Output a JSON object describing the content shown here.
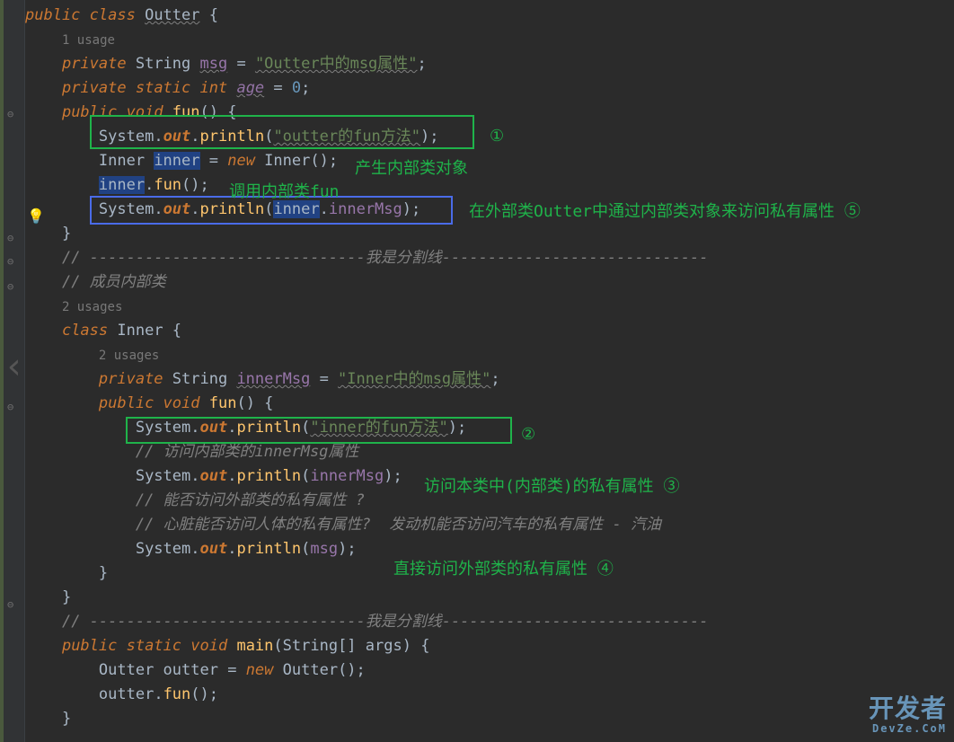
{
  "code": {
    "l1_public": "public ",
    "l1_class": "class ",
    "l1_name": "Outter",
    "l1_brace": " {",
    "l2_usage": "1 usage",
    "l3_private": "private ",
    "l3_type": "String ",
    "l3_var": "msg",
    "l3_eq": " = ",
    "l3_str": "\"Outter中的msg属性\"",
    "l3_semi": ";",
    "l4_private": "private ",
    "l4_static": "static ",
    "l4_int": "int ",
    "l4_var": "age",
    "l4_eq": " = ",
    "l4_num": "0",
    "l4_semi": ";",
    "l5_public": "public ",
    "l5_void": "void ",
    "l5_fun": "fun",
    "l5_paren": "() {",
    "l6_sys": "System",
    "l6_dot1": ".",
    "l6_out": "out",
    "l6_dot2": ".",
    "l6_println": "println",
    "l6_open": "(",
    "l6_str": "\"outter的fun方法\"",
    "l6_close": ");",
    "l7_type": "Inner ",
    "l7_var": "inner",
    "l7_eq": " = ",
    "l7_new": "new ",
    "l7_ctor": "Inner",
    "l7_paren": "();",
    "l8_var": "inner",
    "l8_dot": ".",
    "l8_fun": "fun",
    "l8_paren": "();",
    "l9_sys": "System",
    "l9_dot1": ".",
    "l9_out": "out",
    "l9_dot2": ".",
    "l9_println": "println",
    "l9_open": "(",
    "l9_inner": "inner",
    "l9_dot3": ".",
    "l9_inmsg": "innerMsg",
    "l9_close": ");",
    "l10_brace": "}",
    "l11_comment": "// ------------------------------我是分割线-----------------------------",
    "l12_comment": "// 成员内部类",
    "l13_usage": "2 usages",
    "l14_class": "class ",
    "l14_name": "Inner ",
    "l14_brace": "{",
    "l15_usage": "2 usages",
    "l16_private": "private ",
    "l16_type": "String ",
    "l16_var": "innerMsg",
    "l16_eq": " = ",
    "l16_str": "\"Inner中的msg属性\"",
    "l16_semi": ";",
    "l17_public": "public ",
    "l17_void": "void ",
    "l17_fun": "fun",
    "l17_paren": "() {",
    "l18_sys": "System",
    "l18_dot1": ".",
    "l18_out": "out",
    "l18_dot2": ".",
    "l18_println": "println",
    "l18_open": "(",
    "l18_str": "\"inner的fun方法\"",
    "l18_close": ");",
    "l19_comment": "// 访问内部类的innerMsg属性",
    "l20_sys": "System",
    "l20_dot1": ".",
    "l20_out": "out",
    "l20_dot2": ".",
    "l20_println": "println",
    "l20_open": "(",
    "l20_arg": "innerMsg",
    "l20_close": ");",
    "l21_comment": "// 能否访问外部类的私有属性 ?",
    "l22_comment": "// 心脏能否访问人体的私有属性?  发动机能否访问汽车的私有属性 - 汽油",
    "l23_sys": "System",
    "l23_dot1": ".",
    "l23_out": "out",
    "l23_dot2": ".",
    "l23_println": "println",
    "l23_open": "(",
    "l23_arg": "msg",
    "l23_close": ");",
    "l24_brace": "}",
    "l25_brace": "}",
    "l26_comment": "// ------------------------------我是分割线-----------------------------",
    "l27_public": "public ",
    "l27_static": "static ",
    "l27_void": "void ",
    "l27_main": "main",
    "l27_open": "(",
    "l27_argty": "String[] ",
    "l27_args": "args",
    "l27_close": ") {",
    "l28_type": "Outter ",
    "l28_var": "outter ",
    "l28_eq": "= ",
    "l28_new": "new ",
    "l28_ctor": "Outter",
    "l28_paren": "();",
    "l29_var": "outter",
    "l29_dot": ".",
    "l29_fun": "fun",
    "l29_paren": "();",
    "l30_brace": "}"
  },
  "annotations": {
    "a1": "①",
    "a2": "产生内部类对象",
    "a3": "调用内部类fun",
    "a4": "在外部类Outter中通过内部类对象来访问私有属性 ⑤",
    "a5": "②",
    "a6": "访问本类中(内部类)的私有属性 ③",
    "a7": "直接访问外部类的私有属性 ④"
  },
  "watermark": {
    "main": "开发者",
    "sub": "DevZe.CoM"
  }
}
